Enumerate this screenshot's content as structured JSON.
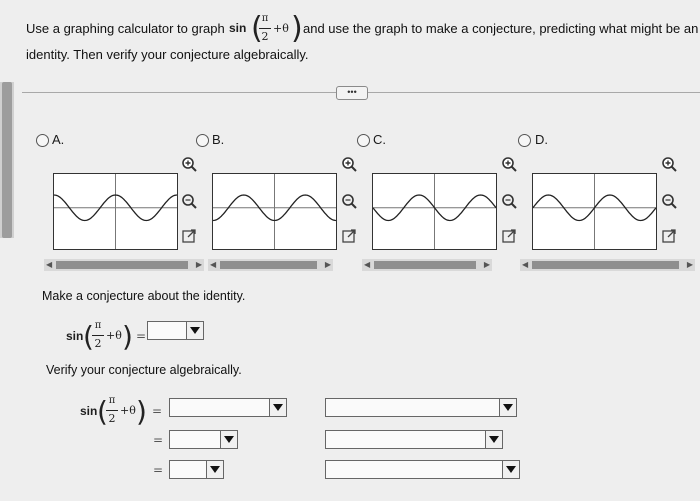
{
  "question": {
    "line1_prefix": "Use a graphing calculator to graph",
    "sin": "sin",
    "pi": "π",
    "two": "2",
    "plus_theta": "+θ",
    "line1_suffix": "and use the graph to make a conjecture, predicting what might be an",
    "line2": "identity. Then verify your conjecture algebraically."
  },
  "more_button": "•••",
  "options": [
    {
      "label": "A.",
      "curve": "cos"
    },
    {
      "label": "B.",
      "curve": "negcos"
    },
    {
      "label": "C.",
      "curve": "negsin"
    },
    {
      "label": "D.",
      "curve": "sin"
    }
  ],
  "icons": {
    "zoom_in": "zoom-in-icon",
    "zoom_out": "zoom-out-icon",
    "expand": "expand-icon"
  },
  "conjecture": {
    "prompt": "Make a conjecture about the identity.",
    "equals": "="
  },
  "verify": {
    "prompt": "Verify your conjecture algebraically.",
    "equals": "="
  },
  "colors": {
    "graph_line": "#222222",
    "scroll_thumb": "#8f8f8f",
    "background": "#eeeeee"
  }
}
